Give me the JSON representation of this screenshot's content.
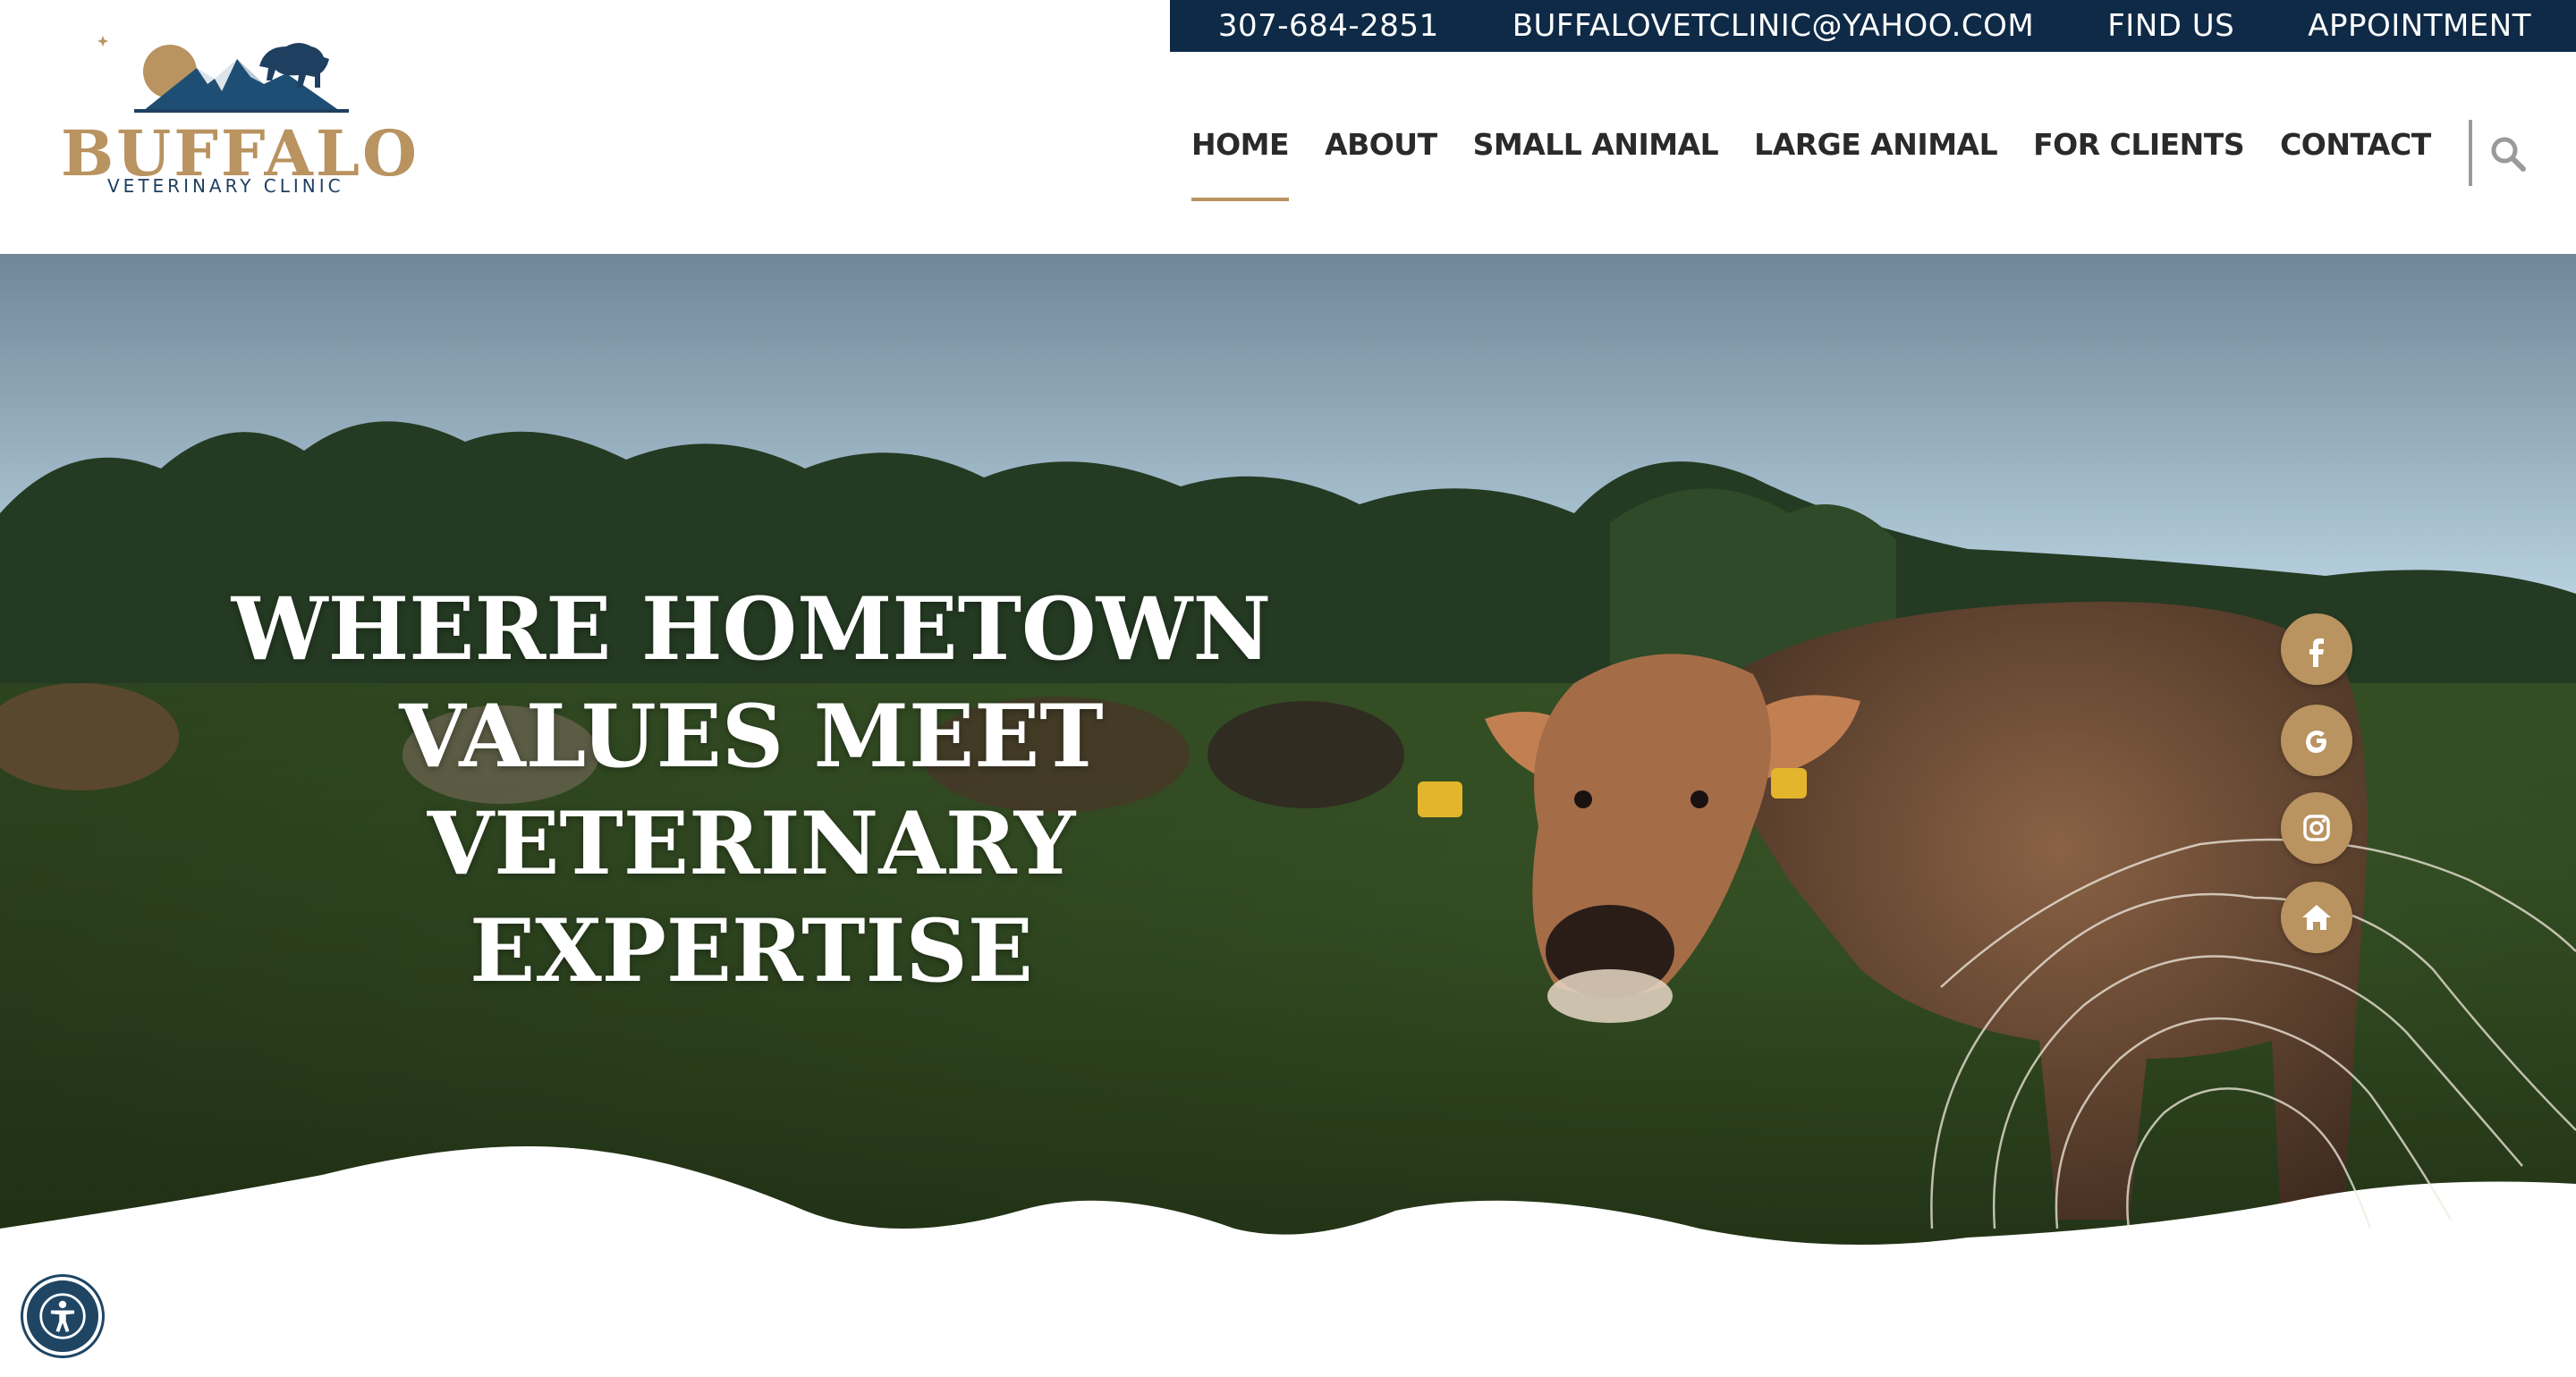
{
  "topbar": {
    "phone": "307-684-2851",
    "email": "BUFFALOVETCLINIC@YAHOO.COM",
    "find_us": "FIND US",
    "appointment": "APPOINTMENT"
  },
  "logo": {
    "word": "BUFFALO",
    "subtitle": "VETERINARY CLINIC"
  },
  "nav": {
    "items": [
      {
        "label": "HOME"
      },
      {
        "label": "ABOUT"
      },
      {
        "label": "SMALL ANIMAL"
      },
      {
        "label": "LARGE ANIMAL"
      },
      {
        "label": "FOR CLIENTS"
      },
      {
        "label": "CONTACT"
      }
    ],
    "search_icon": "search-icon"
  },
  "hero": {
    "title": "WHERE HOMETOWN VALUES MEET VETERINARY EXPERTISE"
  },
  "social": [
    {
      "icon": "facebook-icon"
    },
    {
      "icon": "google-icon"
    },
    {
      "icon": "instagram-icon"
    },
    {
      "icon": "home-icon"
    }
  ],
  "accessibility": {
    "icon": "accessibility-icon"
  },
  "colors": {
    "navy": "#0f2a47",
    "gold": "#b99360",
    "logo_blue": "#1f3f60"
  }
}
